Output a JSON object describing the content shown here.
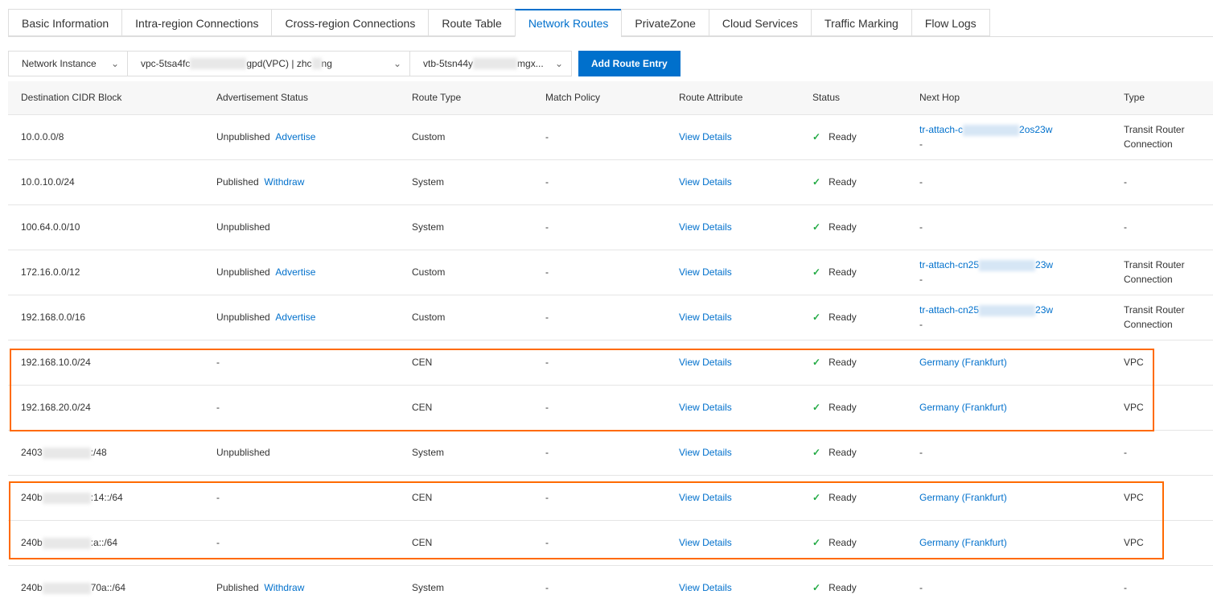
{
  "tabs": [
    "Basic Information",
    "Intra-region Connections",
    "Cross-region Connections",
    "Route Table",
    "Network Routes",
    "PrivateZone",
    "Cloud Services",
    "Traffic Marking",
    "Flow Logs"
  ],
  "active_tab": "Network Routes",
  "toolbar": {
    "instance_type": "Network Instance",
    "vpc_prefix": "vpc-5tsa4fc",
    "vpc_mid": "gpd(VPC) | zhc",
    "vpc_suffix": "ng",
    "vtb_prefix": "vtb-5tsn44y",
    "vtb_suffix": "mgx...",
    "add_label": "Add Route Entry"
  },
  "columns": [
    "Destination CIDR Block",
    "Advertisement Status",
    "Route Type",
    "Match Policy",
    "Route Attribute",
    "Status",
    "Next Hop",
    "Type"
  ],
  "rows": [
    {
      "cidr": "10.0.0.0/8",
      "adv": "Unpublished",
      "action": "Advertise",
      "rtype": "Custom",
      "match": "-",
      "attr": "View Details",
      "status": "Ready",
      "hop": "tr-attach-c",
      "hop_end": "2os23w",
      "hop2": "-",
      "type": "Transit Router Connection"
    },
    {
      "cidr": "10.0.10.0/24",
      "adv": "Published",
      "action": "Withdraw",
      "rtype": "System",
      "match": "-",
      "attr": "View Details",
      "status": "Ready",
      "hop_text": "-",
      "type": "-"
    },
    {
      "cidr": "100.64.0.0/10",
      "adv": "Unpublished",
      "rtype": "System",
      "match": "-",
      "attr": "View Details",
      "status": "Ready",
      "hop_text": "-",
      "type": "-"
    },
    {
      "cidr": "172.16.0.0/12",
      "adv": "Unpublished",
      "action": "Advertise",
      "rtype": "Custom",
      "match": "-",
      "attr": "View Details",
      "status": "Ready",
      "hop": "tr-attach-cn25",
      "hop_end": "23w",
      "hop2": "-",
      "type": "Transit Router Connection"
    },
    {
      "cidr": "192.168.0.0/16",
      "adv": "Unpublished",
      "action": "Advertise",
      "rtype": "Custom",
      "match": "-",
      "attr": "View Details",
      "status": "Ready",
      "hop": "tr-attach-cn25",
      "hop_end": "23w",
      "hop2": "-",
      "type": "Transit Router Connection"
    },
    {
      "cidr": "192.168.10.0/24",
      "adv": "-",
      "rtype": "CEN",
      "match": "-",
      "attr": "View Details",
      "status": "Ready",
      "hop_link": "Germany (Frankfurt)",
      "type": "VPC"
    },
    {
      "cidr": "192.168.20.0/24",
      "adv": "-",
      "rtype": "CEN",
      "match": "-",
      "attr": "View Details",
      "status": "Ready",
      "hop_link": "Germany (Frankfurt)",
      "type": "VPC"
    },
    {
      "cidr": "2403",
      "cidr_end": ":/48",
      "adv": "Unpublished",
      "rtype": "System",
      "match": "-",
      "attr": "View Details",
      "status": "Ready",
      "hop_text": "-",
      "type": "-"
    },
    {
      "cidr": "240b",
      "cidr_end": ":14::/64",
      "adv": "-",
      "rtype": "CEN",
      "match": "-",
      "attr": "View Details",
      "status": "Ready",
      "hop_link": "Germany (Frankfurt)",
      "type": "VPC"
    },
    {
      "cidr": "240b",
      "cidr_end": ":a::/64",
      "adv": "-",
      "rtype": "CEN",
      "match": "-",
      "attr": "View Details",
      "status": "Ready",
      "hop_link": "Germany (Frankfurt)",
      "type": "VPC"
    },
    {
      "cidr": "240b",
      "cidr_end": "70a::/64",
      "adv": "Published",
      "action": "Withdraw",
      "rtype": "System",
      "match": "-",
      "attr": "View Details",
      "status": "Ready",
      "hop_text": "-",
      "type": "-"
    }
  ]
}
